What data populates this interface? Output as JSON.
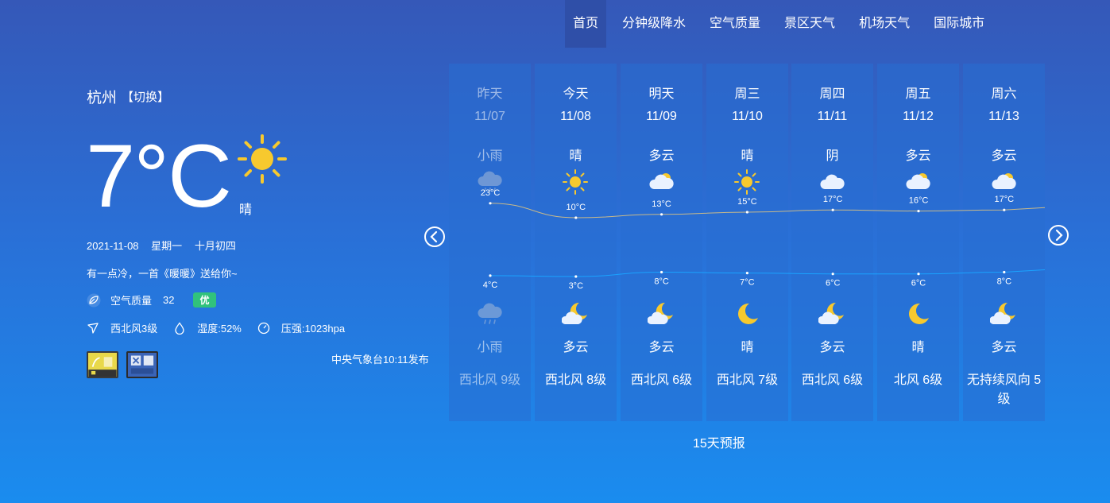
{
  "nav": [
    "首页",
    "分钟级降水",
    "空气质量",
    "景区天气",
    "机场天气",
    "国际城市"
  ],
  "current": {
    "city": "杭州",
    "switch": "【切换】",
    "temp": "7°C",
    "weather": "晴",
    "date": "2021-11-08",
    "weekday": "星期一",
    "lunar": "十月初四",
    "tip": "有一点冷，一首《暖暖》送给你~",
    "aq_label": "空气质量",
    "aq_value": "32",
    "aq_level": "优",
    "wind": "西北风3级",
    "humidity": "湿度:52%",
    "pressure": "压强:1023hpa",
    "publish": "中央气象台10:11发布"
  },
  "forecast": [
    {
      "day": "昨天",
      "date": "11/07",
      "day_weather": "小雨",
      "day_icon": "rain-cloud-icon",
      "high": 23,
      "high_text": "23°C",
      "low": 4,
      "low_text": "4°C",
      "night_icon": "rain-cloud-icon",
      "night_weather": "小雨",
      "wind": "西北风 9级",
      "past": true
    },
    {
      "day": "今天",
      "date": "11/08",
      "day_weather": "晴",
      "day_icon": "sun-icon",
      "high": 10,
      "high_text": "10°C",
      "low": 3,
      "low_text": "3°C",
      "night_icon": "moon-cloud-icon",
      "night_weather": "多云",
      "wind": "西北风 8级"
    },
    {
      "day": "明天",
      "date": "11/09",
      "day_weather": "多云",
      "day_icon": "sun-cloud-icon",
      "high": 13,
      "high_text": "13°C",
      "low": 8,
      "low_text": "8°C",
      "night_icon": "moon-cloud-icon",
      "night_weather": "多云",
      "wind": "西北风 6级"
    },
    {
      "day": "周三",
      "date": "11/10",
      "day_weather": "晴",
      "day_icon": "sun-icon",
      "high": 15,
      "high_text": "15°C",
      "low": 7,
      "low_text": "7°C",
      "night_icon": "moon-icon",
      "night_weather": "晴",
      "wind": "西北风 7级"
    },
    {
      "day": "周四",
      "date": "11/11",
      "day_weather": "阴",
      "day_icon": "cloud-icon",
      "high": 17,
      "high_text": "17°C",
      "low": 6,
      "low_text": "6°C",
      "night_icon": "moon-cloud-icon",
      "night_weather": "多云",
      "wind": "西北风 6级"
    },
    {
      "day": "周五",
      "date": "11/12",
      "day_weather": "多云",
      "day_icon": "sun-cloud-icon",
      "high": 16,
      "high_text": "16°C",
      "low": 6,
      "low_text": "6°C",
      "night_icon": "moon-icon",
      "night_weather": "晴",
      "wind": "北风 6级"
    },
    {
      "day": "周六",
      "date": "11/13",
      "day_weather": "多云",
      "day_icon": "sun-cloud-icon",
      "high": 17,
      "high_text": "17°C",
      "low": 8,
      "low_text": "8°C",
      "night_icon": "moon-cloud-icon",
      "night_weather": "多云",
      "wind": "无持续风向 5级"
    }
  ],
  "more": "15天预报",
  "colors": {
    "sun": "#f7c92e",
    "aq_good": "#31c27c",
    "high_line": "#c8b98a",
    "low_line": "#1aa3ff"
  }
}
